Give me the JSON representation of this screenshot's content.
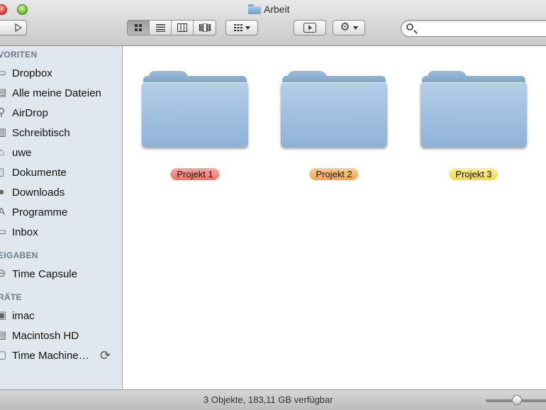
{
  "window": {
    "title": "Arbeit"
  },
  "toolbar": {
    "back_icon": "chevron-left-icon",
    "forward_icon": "play-right-icon",
    "views": [
      "icon-view",
      "list-view",
      "column-view",
      "coverflow-view"
    ],
    "active_view": "icon-view",
    "arrange_icon": "grid-arrange-icon",
    "quicklook_icon": "eye-play-icon",
    "action_icon": "gear-icon",
    "search": {
      "placeholder": "",
      "value": ""
    }
  },
  "sidebar": {
    "favorites_heading": "VORITEN",
    "favorites": [
      {
        "label": "Dropbox",
        "icon": "folder-icon"
      },
      {
        "label": "Alle meine Dateien",
        "icon": "all-files-icon"
      },
      {
        "label": "AirDrop",
        "icon": "airdrop-icon"
      },
      {
        "label": "Schreibtisch",
        "icon": "desktop-icon"
      },
      {
        "label": "uwe",
        "icon": "home-icon"
      },
      {
        "label": "Dokumente",
        "icon": "documents-icon"
      },
      {
        "label": "Downloads",
        "icon": "downloads-icon"
      },
      {
        "label": "Programme",
        "icon": "applications-icon"
      },
      {
        "label": "Inbox",
        "icon": "folder-icon"
      }
    ],
    "shared_heading": "EIGABEN",
    "shared": [
      {
        "label": "Time Capsule",
        "icon": "time-capsule-icon"
      }
    ],
    "devices_heading": "RÄTE",
    "devices": [
      {
        "label": "imac",
        "icon": "imac-icon"
      },
      {
        "label": "Macintosh HD",
        "icon": "hard-disk-icon"
      },
      {
        "label": "Time Machine…",
        "icon": "external-disk-icon"
      }
    ]
  },
  "content": {
    "items": [
      {
        "name": "Projekt 1",
        "label_color": "#f1736b"
      },
      {
        "name": "Projekt 2",
        "label_color": "#f1a957"
      },
      {
        "name": "Projekt 3",
        "label_color": "#efd955"
      }
    ]
  },
  "status": {
    "text": "3 Objekte, 183,11 GB verfügbar"
  }
}
